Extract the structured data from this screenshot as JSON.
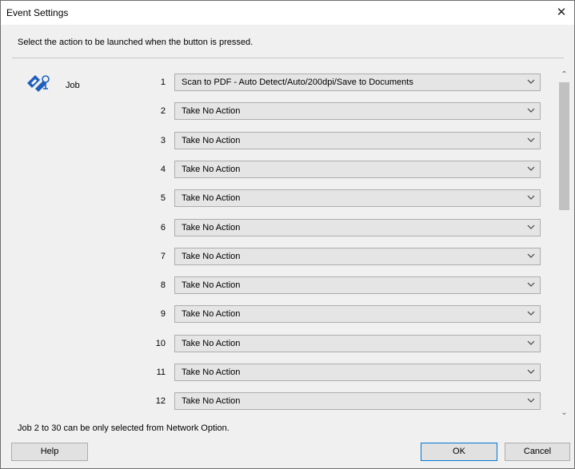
{
  "window": {
    "title": "Event Settings",
    "close_icon": "close-icon"
  },
  "instruction": "Select the action to be launched when the button is pressed.",
  "job": {
    "label": "Job",
    "icon": "scanner-job-icon"
  },
  "rows": [
    {
      "num": "1",
      "value": "Scan to PDF - Auto Detect/Auto/200dpi/Save to Documents"
    },
    {
      "num": "2",
      "value": "Take No Action"
    },
    {
      "num": "3",
      "value": "Take No Action"
    },
    {
      "num": "4",
      "value": "Take No Action"
    },
    {
      "num": "5",
      "value": "Take No Action"
    },
    {
      "num": "6",
      "value": "Take No Action"
    },
    {
      "num": "7",
      "value": "Take No Action"
    },
    {
      "num": "8",
      "value": "Take No Action"
    },
    {
      "num": "9",
      "value": "Take No Action"
    },
    {
      "num": "10",
      "value": "Take No Action"
    },
    {
      "num": "11",
      "value": "Take No Action"
    },
    {
      "num": "12",
      "value": "Take No Action"
    }
  ],
  "footnote": "Job 2 to 30 can be only selected from Network Option.",
  "buttons": {
    "help": "Help",
    "ok": "OK",
    "cancel": "Cancel"
  },
  "colors": {
    "dropdown_bg": "#e5e5e5",
    "default_button_border": "#0078d7"
  }
}
